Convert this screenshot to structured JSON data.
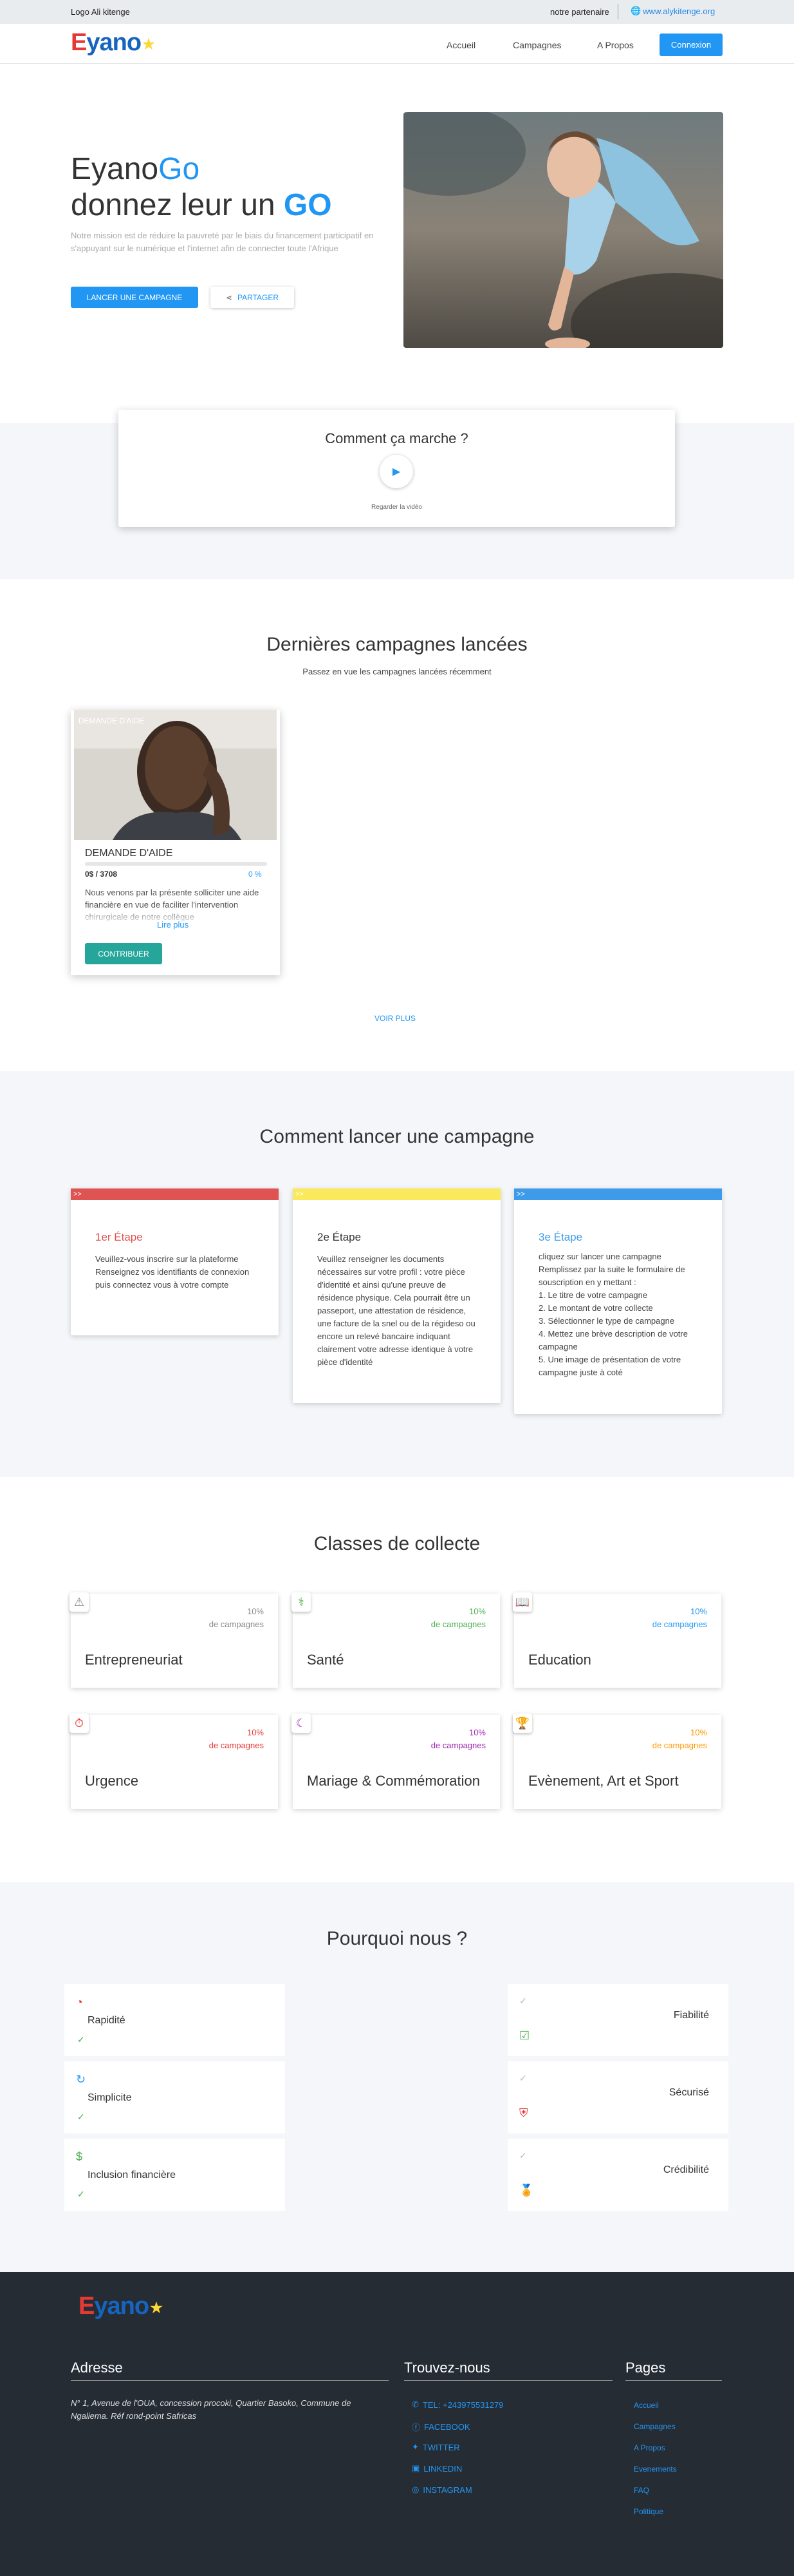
{
  "topbar": {
    "left": "Logo Ali kitenge",
    "partner": "notre partenaire",
    "site": "www.alykitenge.org"
  },
  "nav": {
    "logo": "Eyano",
    "items": [
      "Accueil",
      "Campagnes",
      "A Propos"
    ],
    "login": "Connexion"
  },
  "hero": {
    "title1a": "Eyano",
    "title1b": "Go",
    "title2a": "donnez leur un ",
    "title2b": "GO",
    "subtitle": "Notre mission est de réduire la pauvreté par le biais du financement participatif en s'appuyant sur le numérique et l'internet afin de connecter toute l'Afrique",
    "btn_launch": "LANCER UNE CAMPAGNE",
    "btn_share": "PARTAGER"
  },
  "how": {
    "title": "Comment ça marche ?",
    "video": "Regarder la vidéo"
  },
  "latest": {
    "title": "Dernières campagnes lancées",
    "subtitle": "Passez en vue les campagnes lancées récemment",
    "card": {
      "overlay": "DEMANDE D'AIDE",
      "title": "DEMANDE D'AIDE",
      "amount": "0$ / 3708",
      "pct": "0 %",
      "desc": "Nous venons par la présente solliciter une aide financière en vue de faciliter l'intervention chirurgicale de notre collègue",
      "more": "Lire plus",
      "button": "CONTRIBUER"
    },
    "more": "VOIR PLUS"
  },
  "steps": {
    "title": "Comment lancer une campagne",
    "items": [
      {
        "bar": ">>",
        "title": "1er Étape",
        "text": "Veuillez-vous inscrire sur la plateforme Renseignez vos identifiants de connexion puis connectez vous à votre compte",
        "color": "#e05353"
      },
      {
        "bar": ">>",
        "title": "2e Étape",
        "text": "Veuillez renseigner les documents nécessaires sur votre profil : votre pièce d'identité et ainsi qu'une preuve de résidence physique. Cela pourrait être un passeport, une attestation de résidence, une facture de la snel ou de la régideso ou encore un relevé bancaire indiquant clairement votre adresse identique à votre pièce d'identité",
        "color": "#fbe95c"
      },
      {
        "bar": ">>",
        "title": "3e Étape",
        "intro": "cliquez sur lancer une campagne Remplissez par la suite le formulaire de souscription en y mettant :",
        "list": [
          "Le titre de votre campagne",
          "Le montant de votre collecte",
          "Sélectionner le type de campagne",
          "Mettez une brève description de votre campagne",
          "Une image de présentation de votre campagne juste à coté"
        ],
        "color": "#3d9be9"
      }
    ]
  },
  "classes": {
    "title": "Classes de collecte",
    "pct_label": "de campagnes",
    "items": [
      {
        "name": "Entrepreneuriat",
        "pct": "10%",
        "icon": "⚠",
        "color": "#888888"
      },
      {
        "name": "Santé",
        "pct": "10%",
        "icon": "⚕",
        "color": "#4caf50"
      },
      {
        "name": "Education",
        "pct": "10%",
        "icon": "📖",
        "color": "#2196f3"
      },
      {
        "name": "Urgence",
        "pct": "10%",
        "icon": "⏱",
        "color": "#e53935"
      },
      {
        "name": "Mariage & Commémoration",
        "pct": "10%",
        "icon": "☾",
        "color": "#9c27b0"
      },
      {
        "name": "Evènement, Art et Sport",
        "pct": "10%",
        "icon": "🏆",
        "color": "#ff9800"
      }
    ]
  },
  "why": {
    "title": "Pourquoi nous ?",
    "left": [
      "Rapidité",
      "Simplicite",
      "Inclusion financière"
    ],
    "right": [
      "Fiabilité",
      "Sécurisé",
      "Crédibilité"
    ]
  },
  "footer": {
    "logo": "Eyano",
    "address_title": "Adresse",
    "address": "N° 1, Avenue de l'OUA, concession procoki, Quartier Basoko, Commune de Ngaliema. Réf rond-point Safricas",
    "contact_title": "Trouvez-nous",
    "contacts": [
      {
        "icon": "phone-icon",
        "label": "TEL: +243975531279"
      },
      {
        "icon": "facebook-icon",
        "label": "FACEBOOK"
      },
      {
        "icon": "twitter-icon",
        "label": "TWITTER"
      },
      {
        "icon": "linkedin-icon",
        "label": "LINKEDIN"
      },
      {
        "icon": "instagram-icon",
        "label": "INSTAGRAM"
      }
    ],
    "pages_title": "Pages",
    "pages": [
      "Accueil",
      "Campagnes",
      "A Propos",
      "Evenements",
      "FAQ",
      "Politique"
    ]
  }
}
